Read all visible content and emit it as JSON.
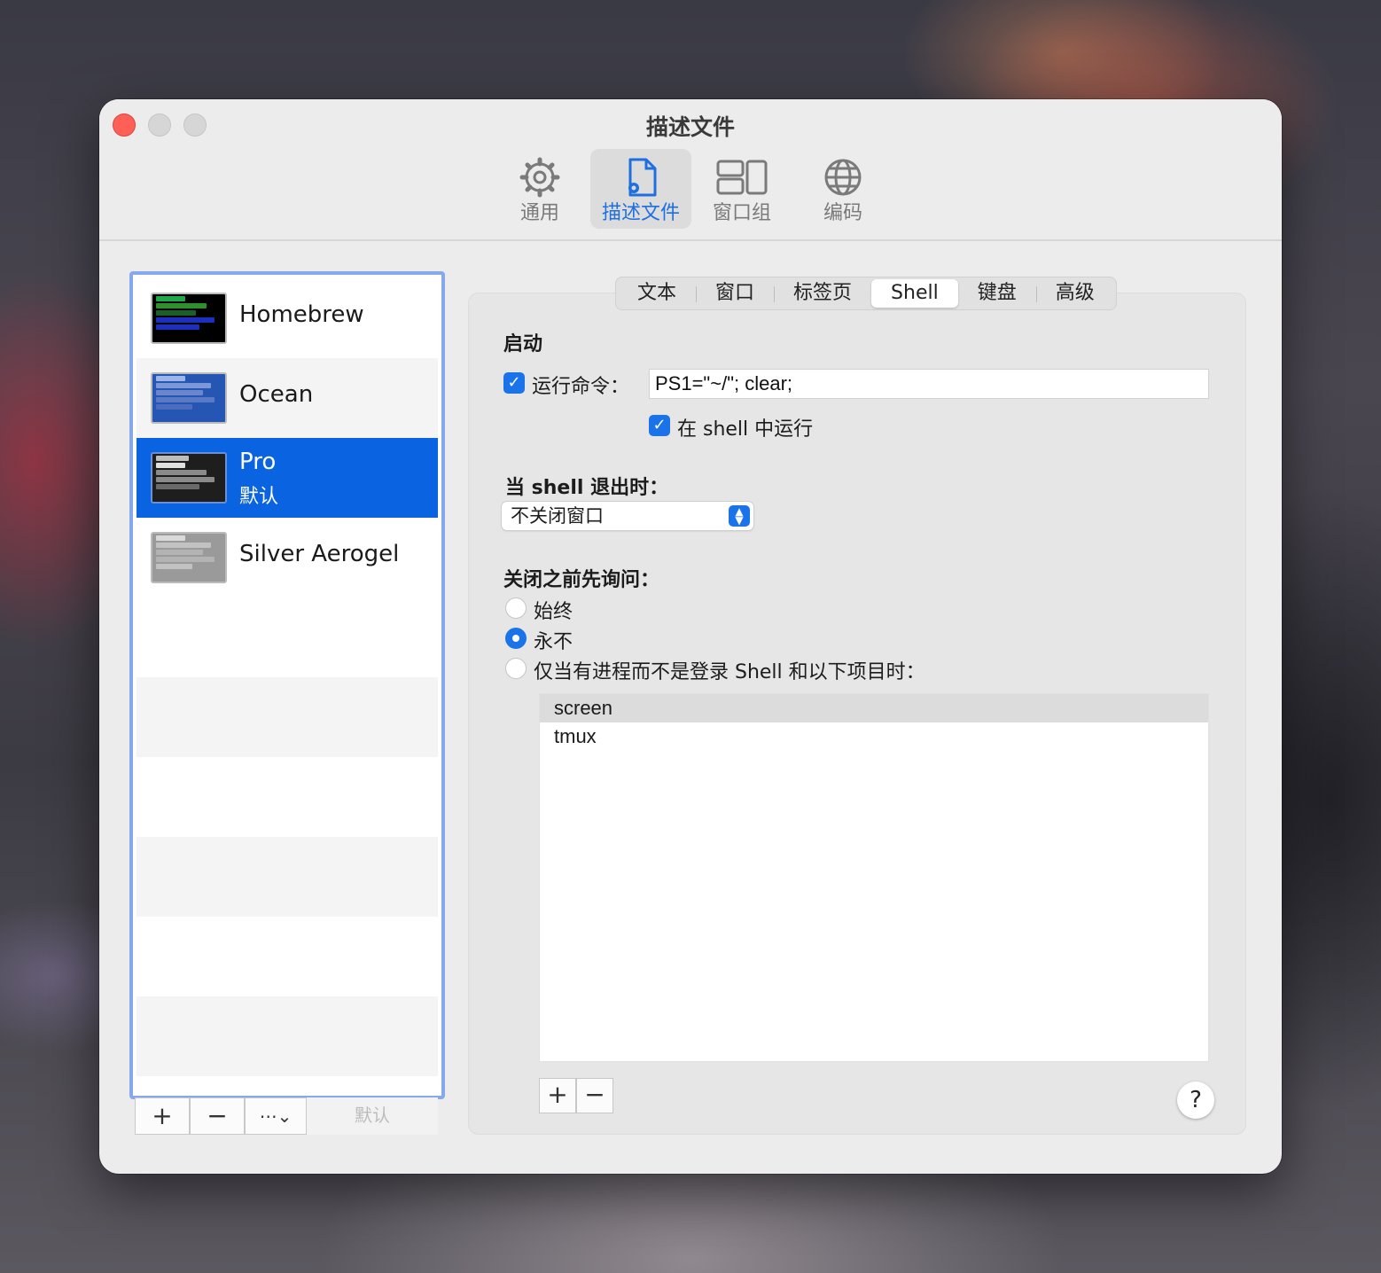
{
  "window": {
    "title": "描述文件"
  },
  "toolbar": {
    "items": [
      {
        "label": "通用",
        "icon": "gear-icon"
      },
      {
        "label": "描述文件",
        "icon": "profile-document-icon",
        "active": true
      },
      {
        "label": "窗口组",
        "icon": "window-group-icon"
      },
      {
        "label": "编码",
        "icon": "globe-icon"
      }
    ]
  },
  "profiles": {
    "items": [
      {
        "name": "Homebrew",
        "subtitle": ""
      },
      {
        "name": "Ocean",
        "subtitle": ""
      },
      {
        "name": "Pro",
        "subtitle": "默认",
        "selected": true
      },
      {
        "name": "Silver Aerogel",
        "subtitle": ""
      }
    ],
    "bar": {
      "add": "+",
      "remove": "−",
      "more": "⋯⌄",
      "default": "默认"
    }
  },
  "tabs": {
    "items": [
      "文本",
      "窗口",
      "标签页",
      "Shell",
      "键盘",
      "高级"
    ],
    "active": "Shell"
  },
  "shell": {
    "startup_heading": "启动",
    "run_command_label": "运行命令：",
    "run_command_checked": true,
    "run_command_value": "PS1=\"~/\"; clear;",
    "run_in_shell_label": "在 shell 中运行",
    "run_in_shell_checked": true,
    "on_exit_label": "当 shell 退出时：",
    "on_exit_value": "不关闭窗口",
    "ask_before_close_label": "关闭之前先询问：",
    "ask_options": [
      {
        "label": "始终",
        "selected": false
      },
      {
        "label": "永不",
        "selected": true
      },
      {
        "label": "仅当有进程而不是登录 Shell 和以下项目时：",
        "selected": false
      }
    ],
    "processes": [
      "screen",
      "tmux"
    ],
    "process_bar": {
      "add": "+",
      "remove": "−"
    },
    "help": "?"
  },
  "colors": {
    "accent": "#1a73e8",
    "selection": "#0a63e0",
    "close": "#fe5f57"
  }
}
